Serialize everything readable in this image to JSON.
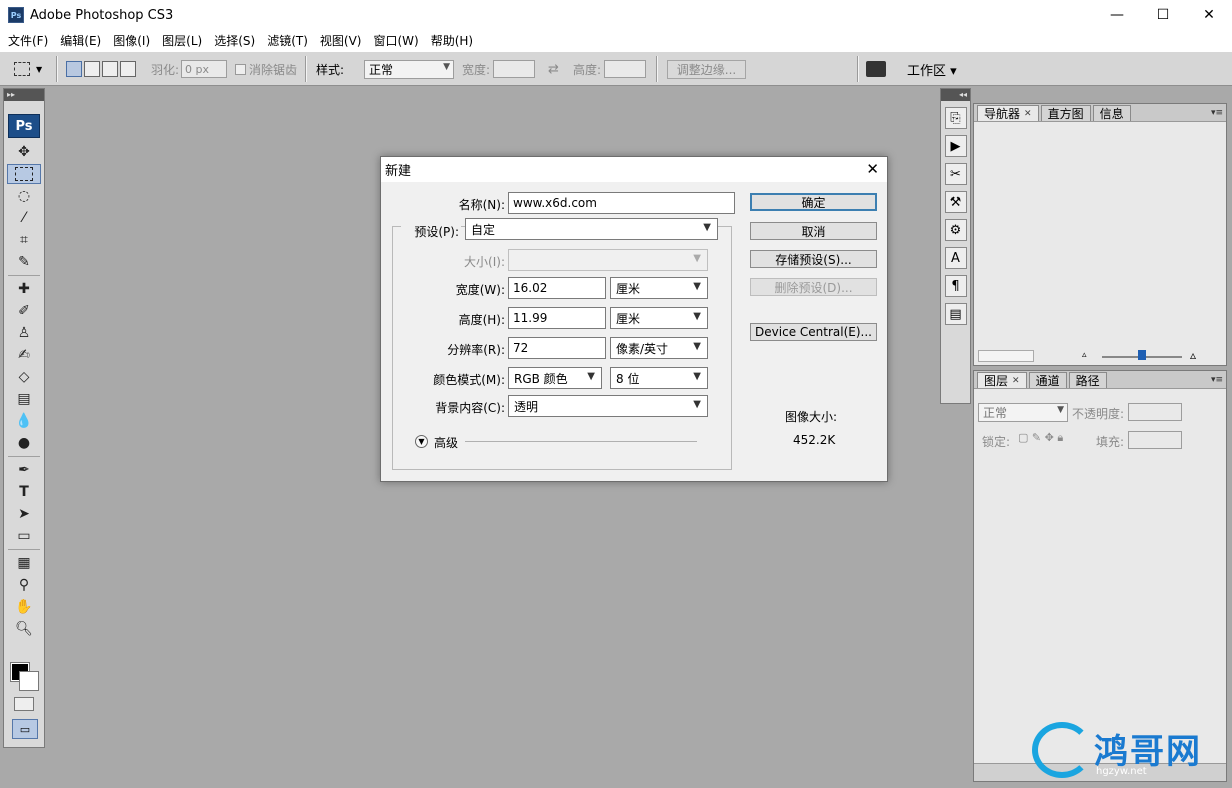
{
  "window": {
    "title": "Adobe Photoshop CS3",
    "icon_text": "Ps",
    "minimize": "—",
    "maximize": "☐",
    "close": "✕"
  },
  "menu": [
    "文件(F)",
    "编辑(E)",
    "图像(I)",
    "图层(L)",
    "选择(S)",
    "滤镜(T)",
    "视图(V)",
    "窗口(W)",
    "帮助(H)"
  ],
  "options": {
    "feather_label": "羽化:",
    "feather_value": "0 px",
    "antialias_label": "消除锯齿",
    "style_label": "样式:",
    "style_value": "正常",
    "width_label": "宽度:",
    "height_label": "高度:",
    "refine_edge": "调整边缘...",
    "workspace": "工作区 ▾"
  },
  "toolbox": {
    "logo": "Ps"
  },
  "panels": {
    "top_tabs": [
      "导航器",
      "直方图",
      "信息"
    ],
    "bottom_tabs": [
      "图层",
      "通道",
      "路径"
    ],
    "blend_mode": "正常",
    "opacity_label": "不透明度:",
    "lock_label": "锁定:",
    "fill_label": "填充:"
  },
  "dialog": {
    "title": "新建",
    "name_label": "名称(N):",
    "name_value": "www.x6d.com",
    "preset_label": "预设(P):",
    "preset_value": "自定",
    "size_label": "大小(I):",
    "width_label": "宽度(W):",
    "width_value": "16.02",
    "width_unit": "厘米",
    "height_label": "高度(H):",
    "height_value": "11.99",
    "height_unit": "厘米",
    "resolution_label": "分辨率(R):",
    "resolution_value": "72",
    "resolution_unit": "像素/英寸",
    "color_mode_label": "颜色模式(M):",
    "color_mode_value": "RGB 颜色",
    "bit_depth": "8 位",
    "background_label": "背景内容(C):",
    "background_value": "透明",
    "advanced_label": "高级",
    "ok": "确定",
    "cancel": "取消",
    "save_preset": "存储预设(S)...",
    "delete_preset": "删除预设(D)...",
    "device_central": "Device Central(E)...",
    "image_size_label": "图像大小:",
    "image_size_value": "452.2K"
  },
  "watermark": {
    "text": "鸿哥网",
    "url": "hgzyw.net"
  }
}
